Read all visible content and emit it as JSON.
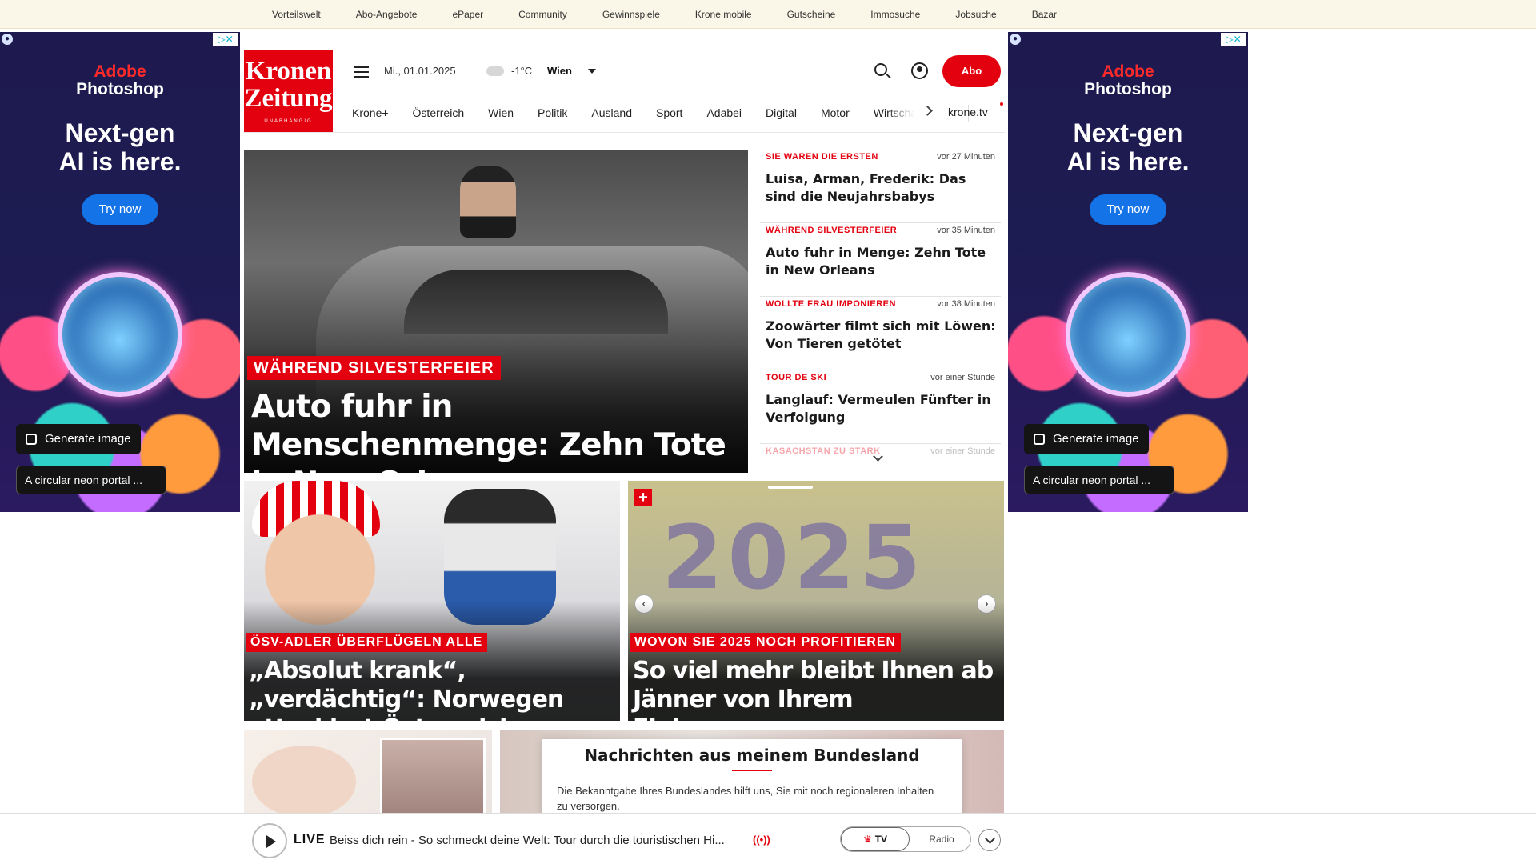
{
  "topbar": {
    "links": [
      "Vorteilswelt",
      "Abo-Angebote",
      "ePaper",
      "Community",
      "Gewinnspiele",
      "Krone mobile",
      "Gutscheine",
      "Immosuche",
      "Jobsuche",
      "Bazar"
    ]
  },
  "ad": {
    "brand_line1": "Adobe",
    "brand_line2": "Photoshop",
    "headline_line1": "Next-gen",
    "headline_line2": "AI is here.",
    "cta": "Try now",
    "generate_label": "Generate image",
    "prompt_text": "A circular neon portal ...",
    "adchoices_label": "▷✕"
  },
  "header": {
    "logo_line1": "Kronen",
    "logo_line2": "Zeitung",
    "logo_tagline": "UNABHÄNGIG",
    "date": "Mi., 01.01.2025",
    "temperature": "-1°C",
    "city": "Wien",
    "abo_label": "Abo"
  },
  "nav": {
    "items": [
      "Krone+",
      "Österreich",
      "Wien",
      "Politik",
      "Ausland",
      "Sport",
      "Adabei",
      "Digital",
      "Motor",
      "Wirtschaft"
    ],
    "tv_label": "krone.tv"
  },
  "hero": {
    "kicker": "WÄHREND SILVESTERFEIER",
    "title": "Auto fuhr in Menschenmenge: Zehn Tote in New Orleans"
  },
  "news_list": [
    {
      "kicker": "SIE WAREN DIE ERSTEN",
      "time": "vor 27 Minuten",
      "headline": "Luisa, Arman, Frederik: Das sind die Neujahrsbabys"
    },
    {
      "kicker": "WÄHREND SILVESTERFEIER",
      "time": "vor 35 Minuten",
      "headline": "Auto fuhr in Menge: Zehn Tote in New Orleans"
    },
    {
      "kicker": "WOLLTE FRAU IMPONIEREN",
      "time": "vor 38 Minuten",
      "headline": "Zoowärter filmt sich mit Löwen: Von Tieren getötet"
    },
    {
      "kicker": "TOUR DE SKI",
      "time": "vor einer Stunde",
      "headline": "Langlauf: Vermeulen Fünfter in Verfolgung"
    },
    {
      "kicker": "KASACHSTAN ZU STARK",
      "time": "vor einer Stunde",
      "headline": ""
    }
  ],
  "cards": [
    {
      "kicker": "ÖSV-ADLER ÜBERFLÜGELN ALLE",
      "title": "„Absolut krank“, „verdächtig“: Norwegen attackiert Österreich"
    },
    {
      "kicker": "WOVON SIE 2025 NOCH PROFITIEREN",
      "title": "So viel mehr bleibt Ihnen ab Jänner von Ihrem Einkommen",
      "badge": "+",
      "image_text": "2025"
    }
  ],
  "region_popup": {
    "title": "Nachrichten aus meinem Bundesland",
    "description": "Die Bekanntgabe Ihres Bundeslandes hilft uns, Sie mit noch regionaleren Inhalten zu versorgen."
  },
  "player": {
    "live_label": "LIVE",
    "title": "Beiss dich rein - So schmeckt deine Welt: Tour durch die touristischen Hi...",
    "broadcast_icon": "((•))",
    "tv_label": "TV",
    "radio_label": "Radio"
  },
  "colors": {
    "brand_red": "#e3000f",
    "ad_background": "#1d1c52",
    "topbar_background": "#fbf7e8"
  }
}
